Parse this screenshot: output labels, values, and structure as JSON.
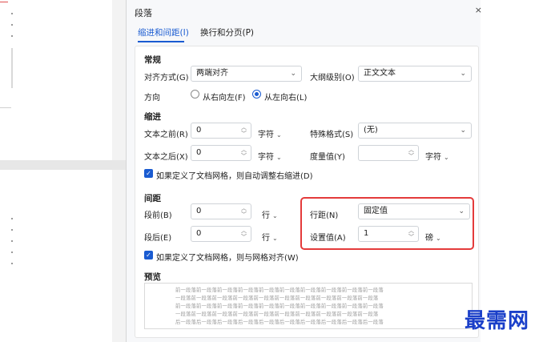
{
  "dialog": {
    "title": "段落",
    "close": "×",
    "tabs": [
      {
        "label": "缩进和间距(I)",
        "active": true
      },
      {
        "label": "换行和分页(P)",
        "active": false
      }
    ]
  },
  "general": {
    "heading": "常规",
    "alignment_label": "对齐方式(G)",
    "alignment_value": "两端对齐",
    "outline_label": "大纲级别(O)",
    "outline_value": "正文文本",
    "direction_label": "方向",
    "rtl_label": "从右向左(F)",
    "ltr_label": "从左向右(L)"
  },
  "indent": {
    "heading": "缩进",
    "before_label": "文本之前(R)",
    "before_value": "0",
    "before_unit": "字符",
    "special_label": "特殊格式(S)",
    "special_value": "(无)",
    "after_label": "文本之后(X)",
    "after_value": "0",
    "after_unit": "字符",
    "measure_label": "度量值(Y)",
    "measure_value": "",
    "measure_unit": "字符",
    "auto_adjust_label": "如果定义了文档网格，则自动调整右缩进(D)"
  },
  "spacing": {
    "heading": "间距",
    "before_label": "段前(B)",
    "before_value": "0",
    "before_unit": "行",
    "line_spacing_label": "行距(N)",
    "line_spacing_value": "固定值",
    "after_label": "段后(E)",
    "after_value": "0",
    "after_unit": "行",
    "set_value_label": "设置值(A)",
    "set_value": "1",
    "set_value_unit": "磅",
    "snap_grid_label": "如果定义了文档网格，则与网格对齐(W)"
  },
  "preview": {
    "heading": "预览",
    "lines": [
      "前一段落前一段落前一段落前一段落前一段落前一段落前一段落前一段落前一段落前一段落",
      "一段落前一段落前一段落前一段落前一段落前一段落前一段落前一段落前一段落前一段落",
      "前一段落前一段落前一段落前一段落前一段落前一段落前一段落前一段落前一段落前一段落",
      "一段落前一段落前一段落前一段落前一段落前一段落前一段落前一段落前一段落前一段落",
      "后一段落后一段落后一段落后一段落后一段落后一段落后一段落后一段落后一段落后一段落"
    ]
  },
  "watermark": "最需网"
}
